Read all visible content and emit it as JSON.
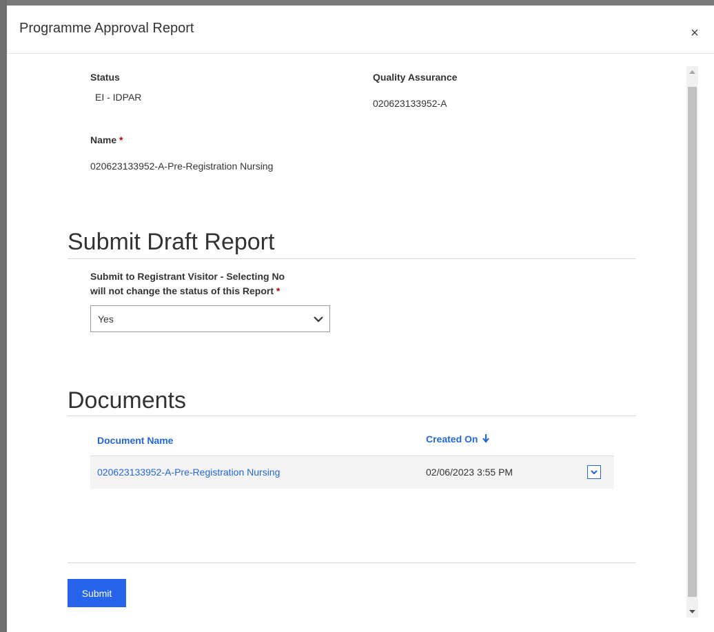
{
  "modal": {
    "title": "Programme Approval Report",
    "close_symbol": "×"
  },
  "fields": {
    "status_label": "Status",
    "status_value": "EI - IDPAR",
    "qa_label": "Quality Assurance",
    "qa_value": "020623133952-A",
    "name_label": "Name",
    "name_required": "*",
    "name_value": "020623133952-A-Pre-Registration Nursing"
  },
  "submit_section": {
    "title": "Submit Draft Report",
    "question_line1": "Submit to Registrant Visitor - Selecting No",
    "question_line2": "will not change the status of this Report",
    "required": "*",
    "selected_value": "Yes"
  },
  "documents": {
    "title": "Documents",
    "columns": [
      "Document Name",
      "Created On"
    ],
    "sort_indicator": "arrow-down-icon",
    "rows": [
      {
        "name": "020623133952-A-Pre-Registration Nursing",
        "created_on": "02/06/2023 3:55 PM"
      }
    ]
  },
  "footer": {
    "submit_label": "Submit"
  },
  "colors": {
    "accent": "#2563eb",
    "link": "#2266d8",
    "required": "#c00000"
  },
  "icons": {
    "close": "close-icon",
    "chevron": "chevron-down-icon",
    "sort": "arrow-down-icon"
  }
}
